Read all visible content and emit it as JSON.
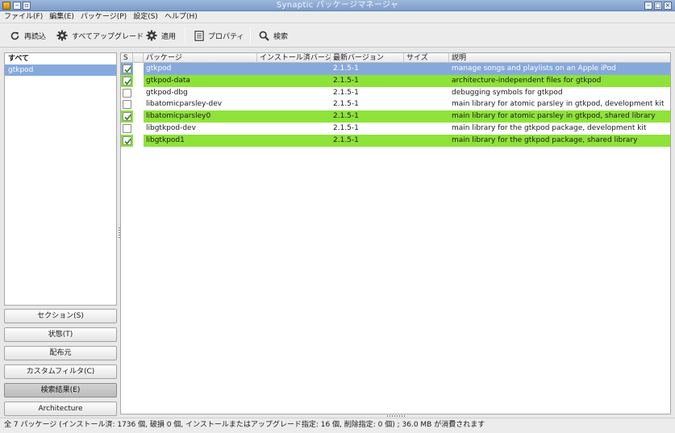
{
  "window": {
    "title": "Synaptic パッケージマネージャ"
  },
  "menubar": {
    "items": [
      "ファイル(F)",
      "編集(E)",
      "パッケージ(P)",
      "設定(S)",
      "ヘルプ(H)"
    ]
  },
  "toolbar": {
    "reload": {
      "label": "再読込",
      "icon": "reload-icon"
    },
    "upgrade_all": {
      "label": "すべてアップグレード",
      "icon": "gear-icon"
    },
    "apply": {
      "label": "適用",
      "icon": "gear-icon"
    },
    "properties": {
      "label": "プロパティ",
      "icon": "properties-icon"
    },
    "search": {
      "label": "検索",
      "icon": "search-icon"
    }
  },
  "left_panel": {
    "items": [
      "すべて",
      "gtkpod"
    ],
    "selected": "gtkpod",
    "filter_buttons": [
      "セクション(S)",
      "状態(T)",
      "配布元",
      "カスタムフィルタ(C)",
      "検索結果(E)",
      "Architecture"
    ],
    "active_filter": "検索結果(E)"
  },
  "table": {
    "columns": [
      "S",
      "パッケージ",
      "インストール済バージョン",
      "最新バージョン",
      "サイズ",
      "説明"
    ],
    "rows": [
      {
        "checked": true,
        "name": "gtkpod",
        "installed": "",
        "latest": "2.1.5-1",
        "size": "",
        "desc": "manage songs and playlists on an Apple iPod",
        "state": "selected"
      },
      {
        "checked": true,
        "name": "gtkpod-data",
        "installed": "",
        "latest": "2.1.5-1",
        "size": "",
        "desc": "architecture-independent files for gtkpod",
        "state": "installed"
      },
      {
        "checked": false,
        "name": "gtkpod-dbg",
        "installed": "",
        "latest": "2.1.5-1",
        "size": "",
        "desc": "debugging symbols for gtkpod",
        "state": "normal"
      },
      {
        "checked": false,
        "name": "libatomicparsley-dev",
        "installed": "",
        "latest": "2.1.5-1",
        "size": "",
        "desc": "main library for atomic parsley in gtkpod, development kit",
        "state": "normal"
      },
      {
        "checked": true,
        "name": "libatomicparsley0",
        "installed": "",
        "latest": "2.1.5-1",
        "size": "",
        "desc": "main library for atomic parsley in gtkpod, shared library",
        "state": "installed"
      },
      {
        "checked": false,
        "name": "libgtkpod-dev",
        "installed": "",
        "latest": "2.1.5-1",
        "size": "",
        "desc": "main library for the gtkpod package, development kit",
        "state": "normal"
      },
      {
        "checked": true,
        "name": "libgtkpod1",
        "installed": "",
        "latest": "2.1.5-1",
        "size": "",
        "desc": "main library for the gtkpod package, shared library",
        "state": "installed"
      }
    ]
  },
  "statusbar": {
    "text": "全 7 パッケージ (インストール済: 1736 個, 破損 0 個, インストールまたはアップグレード指定: 16 個, 削除指定: 0 個) ; 36.0 MB が消費されます"
  },
  "colors": {
    "selection": "#86a9dc",
    "installed": "#8ee339",
    "titlebar": "#7b9dcb"
  }
}
